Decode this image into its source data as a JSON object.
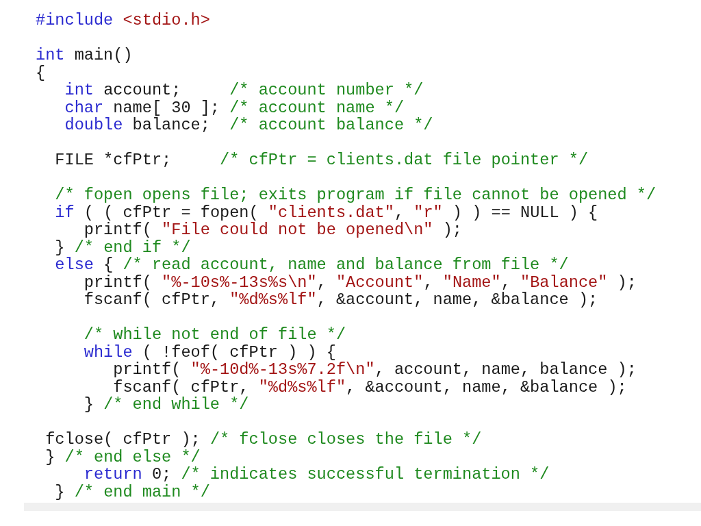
{
  "code_blocks": [
    [
      [
        {
          "kind": "keyword",
          "text": "#include"
        },
        {
          "kind": "string",
          "text": " <stdio.h>"
        }
      ]
    ],
    [
      [
        {
          "kind": "keyword",
          "text": "int"
        },
        {
          "kind": "plain",
          "text": " main()"
        }
      ],
      [
        {
          "kind": "plain",
          "text": "{"
        }
      ],
      [
        {
          "kind": "keyword",
          "text": "   int"
        },
        {
          "kind": "plain",
          "text": " account;     "
        },
        {
          "kind": "comment",
          "text": "/* account number */"
        }
      ],
      [
        {
          "kind": "keyword",
          "text": "   char"
        },
        {
          "kind": "plain",
          "text": " name[ 30 ]; "
        },
        {
          "kind": "comment",
          "text": "/* account name */"
        }
      ],
      [
        {
          "kind": "keyword",
          "text": "   double"
        },
        {
          "kind": "plain",
          "text": " balance;  "
        },
        {
          "kind": "comment",
          "text": "/* account balance */"
        }
      ]
    ],
    [
      [
        {
          "kind": "plain",
          "text": "  FILE *cfPtr;     "
        },
        {
          "kind": "comment",
          "text": "/* cfPtr = clients.dat file pointer */"
        }
      ]
    ],
    [
      [
        {
          "kind": "comment",
          "text": "  /* fopen opens file; exits program if file cannot be opened */"
        }
      ],
      [
        {
          "kind": "keyword",
          "text": "  if"
        },
        {
          "kind": "plain",
          "text": " ( ( cfPtr = fopen( "
        },
        {
          "kind": "string",
          "text": "\"clients.dat\""
        },
        {
          "kind": "plain",
          "text": ", "
        },
        {
          "kind": "string",
          "text": "\"r\""
        },
        {
          "kind": "plain",
          "text": " ) ) == NULL ) {"
        }
      ],
      [
        {
          "kind": "plain",
          "text": "     printf( "
        },
        {
          "kind": "string",
          "text": "\"File could not be opened\\n\""
        },
        {
          "kind": "plain",
          "text": " );"
        }
      ],
      [
        {
          "kind": "plain",
          "text": "  } "
        },
        {
          "kind": "comment",
          "text": "/* end if */"
        }
      ],
      [
        {
          "kind": "keyword",
          "text": "  else"
        },
        {
          "kind": "plain",
          "text": " { "
        },
        {
          "kind": "comment",
          "text": "/* read account, name and balance from file */"
        }
      ],
      [
        {
          "kind": "plain",
          "text": "     printf( "
        },
        {
          "kind": "string",
          "text": "\"%-10s%-13s%s\\n\""
        },
        {
          "kind": "plain",
          "text": ", "
        },
        {
          "kind": "string",
          "text": "\"Account\""
        },
        {
          "kind": "plain",
          "text": ", "
        },
        {
          "kind": "string",
          "text": "\"Name\""
        },
        {
          "kind": "plain",
          "text": ", "
        },
        {
          "kind": "string",
          "text": "\"Balance\""
        },
        {
          "kind": "plain",
          "text": " );"
        }
      ],
      [
        {
          "kind": "plain",
          "text": "     fscanf( cfPtr, "
        },
        {
          "kind": "string",
          "text": "\"%d%s%lf\""
        },
        {
          "kind": "plain",
          "text": ", &account, name, &balance );"
        }
      ]
    ],
    [
      [
        {
          "kind": "comment",
          "text": "     /* while not end of file */"
        }
      ],
      [
        {
          "kind": "keyword",
          "text": "     while"
        },
        {
          "kind": "plain",
          "text": " ( !feof( cfPtr ) ) {"
        }
      ],
      [
        {
          "kind": "plain",
          "text": "        printf( "
        },
        {
          "kind": "string",
          "text": "\"%-10d%-13s%7.2f\\n\""
        },
        {
          "kind": "plain",
          "text": ", account, name, balance );"
        }
      ],
      [
        {
          "kind": "plain",
          "text": "        fscanf( cfPtr, "
        },
        {
          "kind": "string",
          "text": "\"%d%s%lf\""
        },
        {
          "kind": "plain",
          "text": ", &account, name, &balance );"
        }
      ],
      [
        {
          "kind": "plain",
          "text": "     } "
        },
        {
          "kind": "comment",
          "text": "/* end while */"
        }
      ]
    ],
    [
      [
        {
          "kind": "plain",
          "text": " fclose( cfPtr ); "
        },
        {
          "kind": "comment",
          "text": "/* fclose closes the file */"
        }
      ],
      [
        {
          "kind": "plain",
          "text": " } "
        },
        {
          "kind": "comment",
          "text": "/* end else */"
        }
      ],
      [
        {
          "kind": "keyword",
          "text": "     return"
        },
        {
          "kind": "plain",
          "text": " 0; "
        },
        {
          "kind": "comment",
          "text": "/* indicates successful termination */"
        }
      ],
      [
        {
          "kind": "plain",
          "text": "  } "
        },
        {
          "kind": "comment",
          "text": "/* end main */"
        }
      ]
    ]
  ]
}
